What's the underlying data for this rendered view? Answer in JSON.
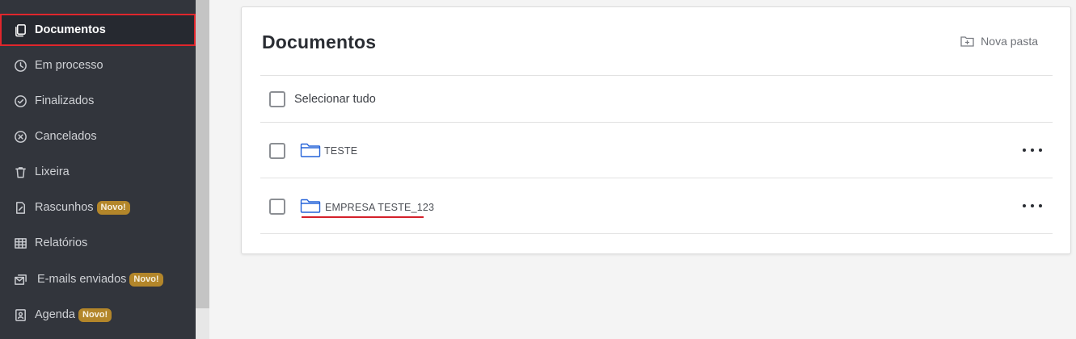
{
  "sidebar": {
    "items": [
      {
        "label": "Documentos",
        "icon": "copy-icon",
        "active": true
      },
      {
        "label": "Em processo",
        "icon": "clock-icon"
      },
      {
        "label": "Finalizados",
        "icon": "check-circle-icon"
      },
      {
        "label": "Cancelados",
        "icon": "x-circle-icon"
      },
      {
        "label": "Lixeira",
        "icon": "trash-icon"
      },
      {
        "label": "Rascunhos",
        "icon": "draft-icon",
        "badge": "Novo!"
      },
      {
        "label": "Relatórios",
        "icon": "table-icon"
      },
      {
        "label": "E-mails enviados",
        "icon": "mail-sent-icon",
        "badge": "Novo!"
      },
      {
        "label": "Agenda",
        "icon": "contacts-icon",
        "badge": "Novo!"
      }
    ]
  },
  "main": {
    "title": "Documentos",
    "new_folder_label": "Nova pasta",
    "select_all_label": "Selecionar tudo",
    "folders": [
      {
        "name": "TESTE"
      },
      {
        "name": "EMPRESA TESTE_123"
      }
    ]
  },
  "colors": {
    "sidebar_bg": "#32353c",
    "active_border": "#e0262c",
    "badge_bg": "#b3862a",
    "folder_icon": "#2563d9"
  }
}
